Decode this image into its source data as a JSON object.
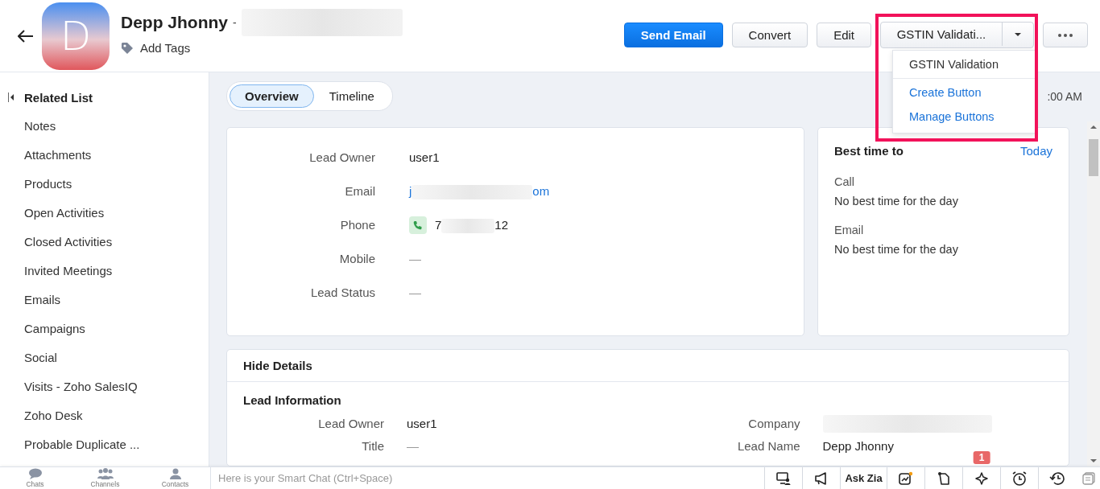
{
  "record": {
    "avatar_letter": "D",
    "name": "Depp Jhonny",
    "separator": "-",
    "subtitle_redacted": true,
    "tags_label": "Add Tags"
  },
  "actions": [
    {
      "label": "Send Email",
      "kind": "primary"
    },
    {
      "label": "Convert",
      "kind": "default"
    },
    {
      "label": "Edit",
      "kind": "default"
    },
    {
      "label": "GSTIN Validati...",
      "kind": "split"
    },
    {
      "kind": "more"
    }
  ],
  "dropdown": {
    "items": [
      {
        "label": "GSTIN Validation",
        "kind": "action"
      },
      {
        "label": "Create Button",
        "kind": "link"
      },
      {
        "label": "Manage Buttons",
        "kind": "link"
      }
    ]
  },
  "highlight_frame": true,
  "sidebar": {
    "title": "Related List",
    "items": [
      "Notes",
      "Attachments",
      "Products",
      "Open Activities",
      "Closed Activities",
      "Invited Meetings",
      "Emails",
      "Campaigns",
      "Social",
      "Visits - Zoho SalesIQ",
      "Zoho Desk",
      "Probable Duplicate ..."
    ]
  },
  "tabs": [
    {
      "label": "Overview",
      "selected": true
    },
    {
      "label": "Timeline",
      "selected": false
    }
  ],
  "time_text": ":00 AM",
  "summary_fields": [
    {
      "label": "Lead Owner",
      "kind": "text",
      "value": "user1"
    },
    {
      "label": "Email",
      "kind": "email",
      "value_start": "j",
      "value_end": "om"
    },
    {
      "label": "Phone",
      "kind": "phone",
      "value_start": "7",
      "value_end": "12"
    },
    {
      "label": "Mobile",
      "kind": "empty",
      "value": "—"
    },
    {
      "label": "Lead Status",
      "kind": "empty",
      "value": "—"
    }
  ],
  "best_time": {
    "title": "Best time to",
    "link": "Today",
    "sections": [
      {
        "label": "Call",
        "value": "No best time for the day"
      },
      {
        "label": "Email",
        "value": "No best time for the day"
      }
    ]
  },
  "details": {
    "toggle": "Hide Details",
    "section": "Lead Information",
    "fields": [
      {
        "label": "Lead Owner",
        "kind": "text",
        "value": "user1"
      },
      {
        "label": "Company",
        "kind": "redacted"
      },
      {
        "label": "Title",
        "kind": "empty",
        "value": "—"
      },
      {
        "label": "Lead Name",
        "kind": "text",
        "value": "Depp Jhonny"
      }
    ]
  },
  "footer": {
    "tabs": [
      {
        "label": "Chats"
      },
      {
        "label": "Channels"
      },
      {
        "label": "Contacts"
      }
    ],
    "chat_placeholder": "Here is your Smart Chat (Ctrl+Space)",
    "tools": [
      {
        "kind": "icon"
      },
      {
        "kind": "icon"
      },
      {
        "kind": "text",
        "label": "Ask Zia"
      },
      {
        "kind": "icon"
      },
      {
        "kind": "icon"
      },
      {
        "kind": "icon",
        "badge": "1"
      },
      {
        "kind": "icon"
      },
      {
        "kind": "icon"
      },
      {
        "kind": "icon"
      }
    ]
  }
}
